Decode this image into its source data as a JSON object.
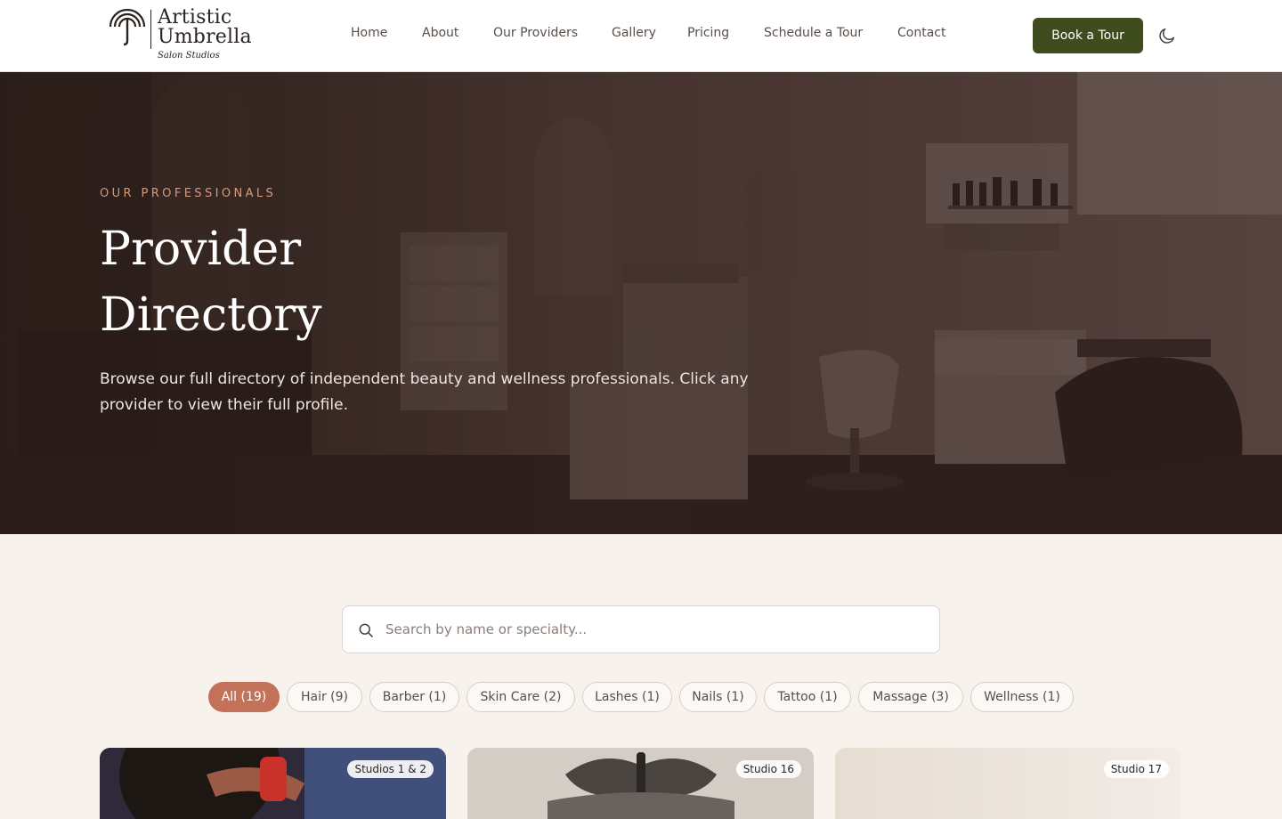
{
  "brand": {
    "name_line1": "Artistic",
    "name_line2": "Umbrella",
    "tagline": "Salon Studios"
  },
  "nav": {
    "items": [
      {
        "label": "Home"
      },
      {
        "label": "About"
      },
      {
        "label": "Our Providers"
      },
      {
        "label": "Gallery"
      },
      {
        "label": "Pricing"
      },
      {
        "label": "Schedule a Tour"
      },
      {
        "label": "Contact"
      }
    ],
    "cta_label": "Book a Tour",
    "theme_icon": "moon-icon"
  },
  "hero": {
    "eyebrow": "OUR PROFESSIONALS",
    "title": "Provider Directory",
    "description": "Browse our full directory of independent beauty and wellness professionals. Click any provider to view their full profile."
  },
  "search": {
    "placeholder": "Search by name or specialty...",
    "value": ""
  },
  "filters": [
    {
      "label": "All (19)",
      "active": true
    },
    {
      "label": "Hair (9)",
      "active": false
    },
    {
      "label": "Barber (1)",
      "active": false
    },
    {
      "label": "Skin Care (2)",
      "active": false
    },
    {
      "label": "Lashes (1)",
      "active": false
    },
    {
      "label": "Nails (1)",
      "active": false
    },
    {
      "label": "Tattoo (1)",
      "active": false
    },
    {
      "label": "Massage (3)",
      "active": false
    },
    {
      "label": "Wellness (1)",
      "active": false
    }
  ],
  "cards": [
    {
      "studio": "Studios 1 & 2"
    },
    {
      "studio": "Studio 16"
    },
    {
      "studio": "Studio 17"
    }
  ],
  "colors": {
    "accent": "#c4715a",
    "cta": "#3f4d1e",
    "eyebrow": "#d49a7c",
    "page_bg": "#f7f2ec"
  }
}
